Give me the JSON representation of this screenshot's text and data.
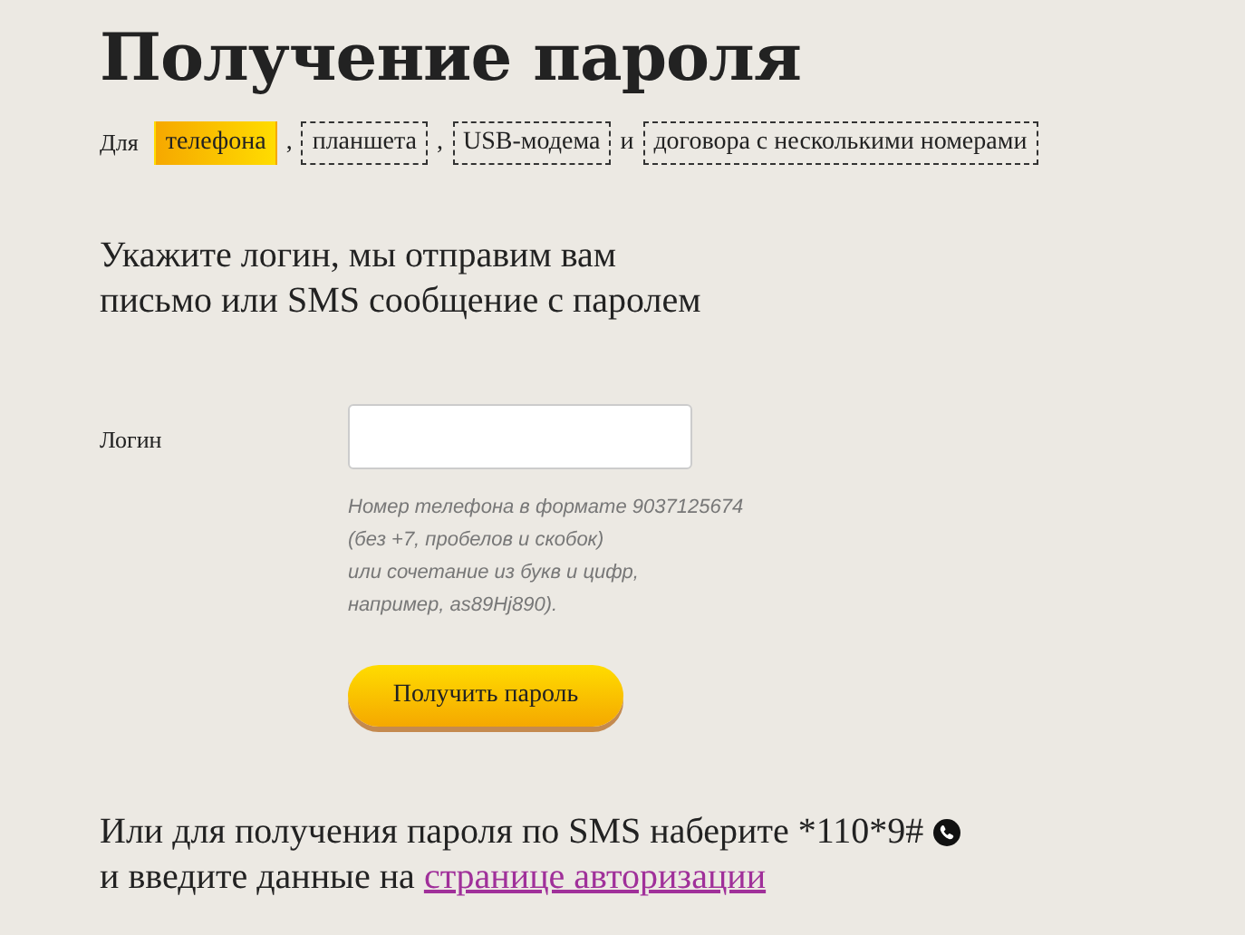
{
  "title": "Получение пароля",
  "device_selector": {
    "prefix": "Для",
    "items": [
      {
        "kind": "option",
        "label": "телефона",
        "selected": true
      },
      {
        "kind": "separator",
        "label": ","
      },
      {
        "kind": "option",
        "label": "планшета",
        "selected": false
      },
      {
        "kind": "separator",
        "label": ","
      },
      {
        "kind": "option",
        "label": "USB-модема",
        "selected": false
      },
      {
        "kind": "separator",
        "label": "и"
      },
      {
        "kind": "option",
        "label": "договора с несколькими номерами",
        "selected": false
      }
    ]
  },
  "intro": [
    "Укажите логин, мы отправим вам",
    "письмо или SMS сообщение с паролем"
  ],
  "form": {
    "label": "Логин",
    "hint": [
      "Номер телефона в формате 9037125674",
      "(без +7, пробелов и скобок)",
      "или сочетание из букв и цифр,",
      "например, as89Hj890)."
    ],
    "button": "Получить пароль"
  },
  "sms_note": {
    "line1": "Или для получения пароля по SMS наберите *110*9#",
    "line2": "и введите данные на",
    "link": "странице авторизации"
  }
}
